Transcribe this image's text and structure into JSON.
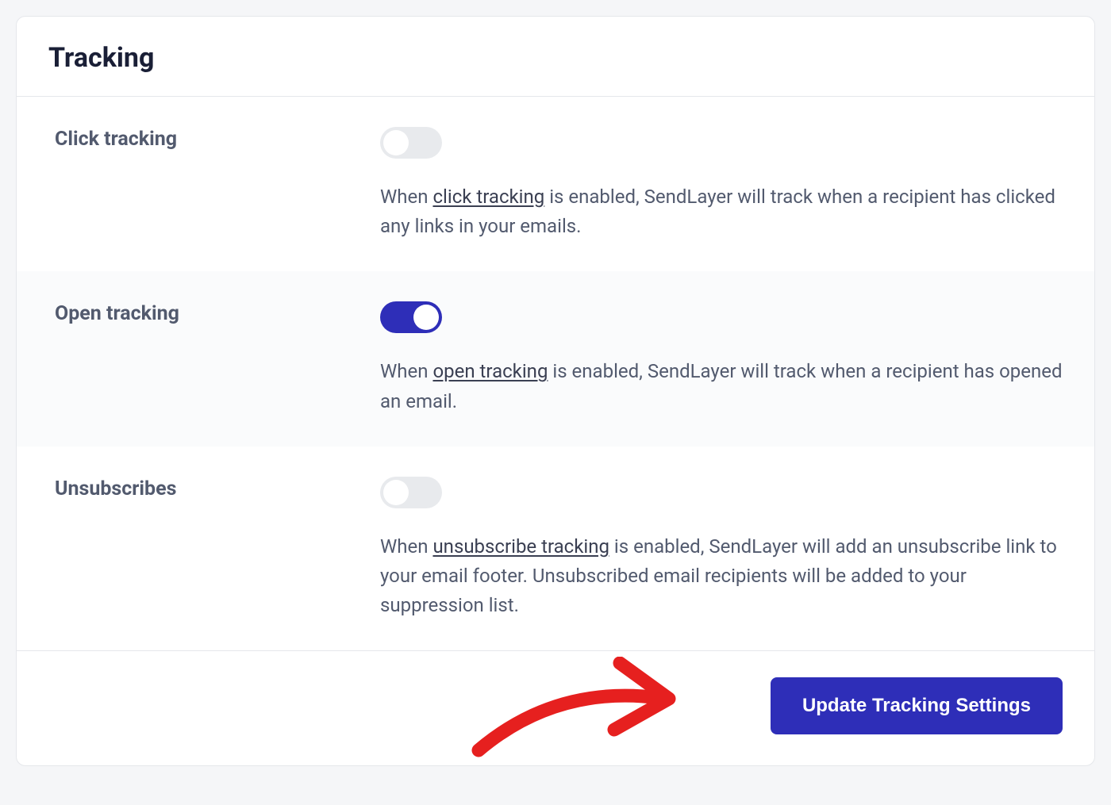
{
  "card": {
    "title": "Tracking",
    "settings": [
      {
        "label": "Click tracking",
        "enabled": false,
        "desc_pre": "When ",
        "desc_link": "click tracking",
        "desc_post": " is enabled, SendLayer will track when a recipient has clicked any links in your emails."
      },
      {
        "label": "Open tracking",
        "enabled": true,
        "desc_pre": "When ",
        "desc_link": "open tracking",
        "desc_post": " is enabled, SendLayer will track when a recipient has opened an email."
      },
      {
        "label": "Unsubscribes",
        "enabled": false,
        "desc_pre": "When ",
        "desc_link": "unsubscribe tracking",
        "desc_post": " is enabled, SendLayer will add an unsubscribe link to your email footer. Unsubscribed email recipients will be added to your suppression list."
      }
    ],
    "footer": {
      "button_label": "Update Tracking Settings"
    }
  },
  "colors": {
    "accent": "#2e2eb8",
    "annotation": "#e6201f"
  }
}
